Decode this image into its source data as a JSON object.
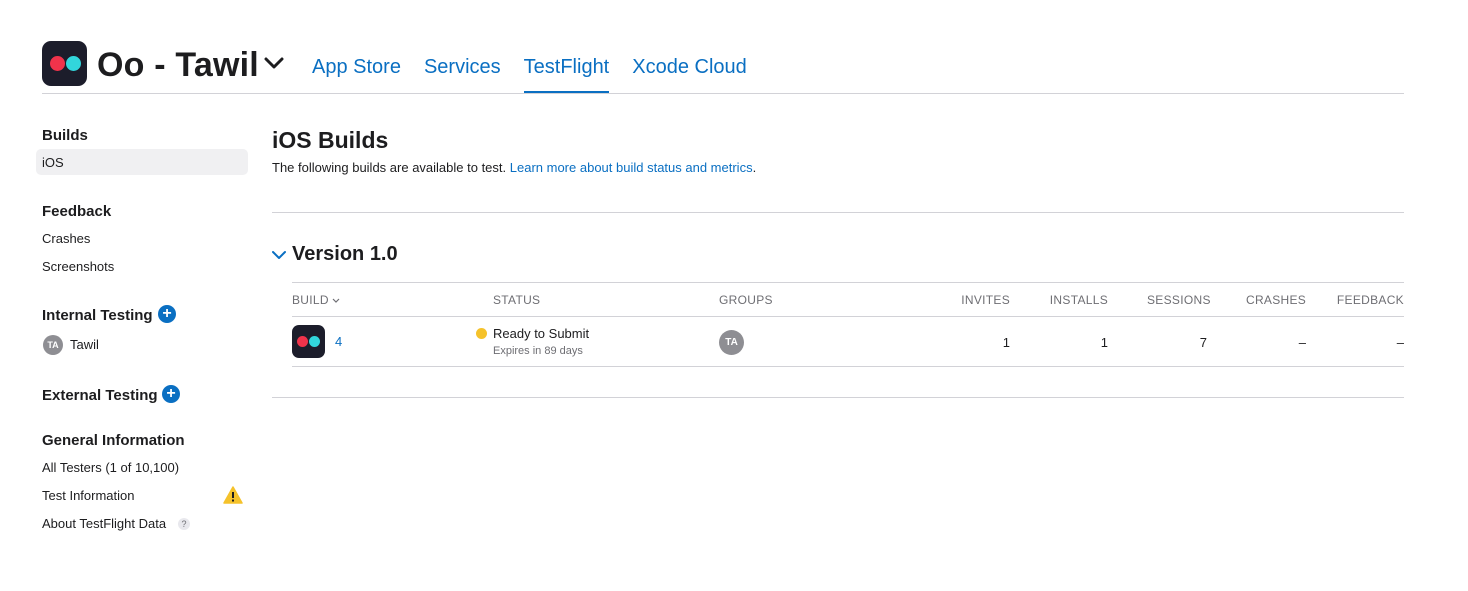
{
  "app": {
    "name": "Oo - Tawil"
  },
  "tabs": [
    {
      "label": "App Store",
      "active": false
    },
    {
      "label": "Services",
      "active": false
    },
    {
      "label": "TestFlight",
      "active": true
    },
    {
      "label": "Xcode Cloud",
      "active": false
    }
  ],
  "sidebar": {
    "builds_heading": "Builds",
    "builds_ios": "iOS",
    "feedback_heading": "Feedback",
    "crashes": "Crashes",
    "screenshots": "Screenshots",
    "internal_heading": "Internal Testing",
    "internal_group_initials": "TA",
    "internal_group_name": "Tawil",
    "external_heading": "External Testing",
    "general_heading": "General Information",
    "all_testers": "All Testers (1 of 10,100)",
    "test_information": "Test Information",
    "about_data": "About TestFlight Data",
    "help_glyph": "?"
  },
  "main": {
    "title": "iOS Builds",
    "subtitle": "The following builds are available to test.",
    "learn_more": "Learn more about build status and metrics",
    "version_title": "Version 1.0"
  },
  "table": {
    "headers": {
      "build": "BUILD",
      "status": "STATUS",
      "groups": "GROUPS",
      "invites": "INVITES",
      "installs": "INSTALLS",
      "sessions": "SESSIONS",
      "crashes": "CRASHES",
      "feedback": "FEEDBACK"
    },
    "rows": [
      {
        "build": "4",
        "status": "Ready to Submit",
        "expires": "Expires in 89 days",
        "group_initials": "TA",
        "invites": "1",
        "installs": "1",
        "sessions": "7",
        "crashes": "–",
        "feedback": "–"
      }
    ]
  },
  "colors": {
    "accent": "#0a6fc2",
    "status_ready": "#f5c22b",
    "warning": "#f5c22b"
  }
}
